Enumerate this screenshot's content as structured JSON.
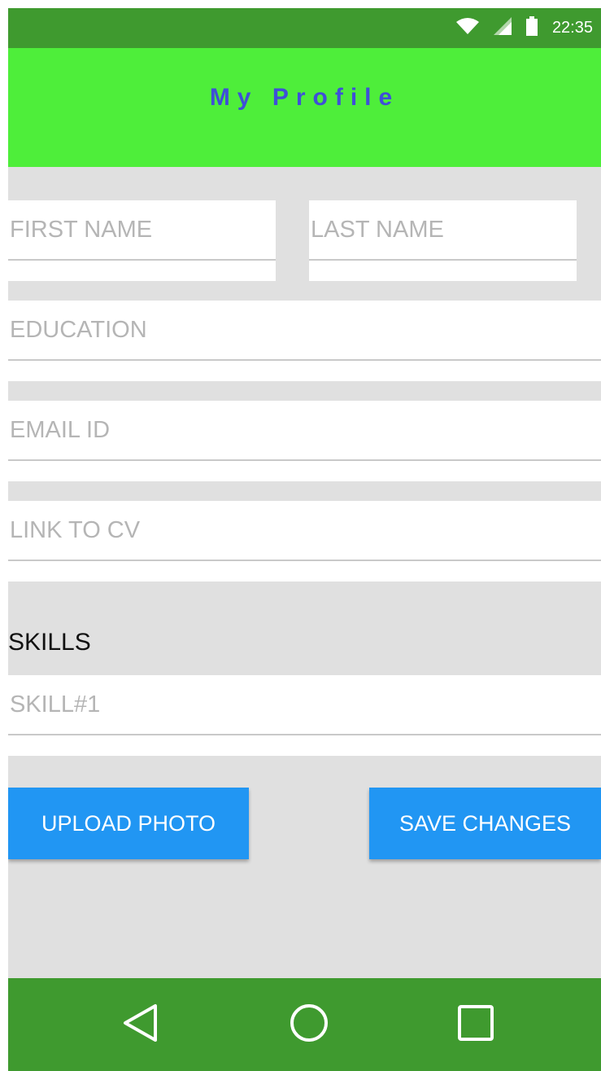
{
  "status_bar": {
    "time": "22:35",
    "icons": [
      "wifi-icon",
      "cell-signal-icon",
      "battery-icon"
    ]
  },
  "app_bar": {
    "title": "My Profile"
  },
  "form": {
    "first_name": {
      "placeholder": "FIRST NAME",
      "value": ""
    },
    "last_name": {
      "placeholder": "LAST NAME",
      "value": ""
    },
    "education": {
      "placeholder": "EDUCATION",
      "value": ""
    },
    "email": {
      "placeholder": "EMAIL ID",
      "value": ""
    },
    "cv_link": {
      "placeholder": "LINK TO CV",
      "value": ""
    },
    "skills_label": "SKILLS",
    "skill_1": {
      "placeholder": "SKILL#1",
      "value": ""
    }
  },
  "buttons": {
    "upload_photo": "UPLOAD PHOTO",
    "save_changes": "SAVE CHANGES"
  },
  "nav_bar": {
    "icons": [
      "back-icon",
      "home-icon",
      "recents-icon"
    ]
  },
  "colors": {
    "status_bar": "#3f9a2f",
    "app_bar": "#4eee3a",
    "title": "#3f4fd8",
    "button": "#2196f3",
    "background": "#e0e0e0"
  }
}
